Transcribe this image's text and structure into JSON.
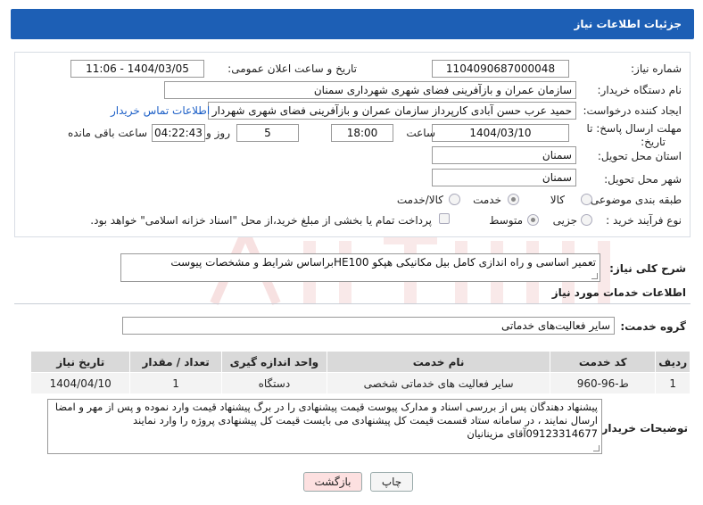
{
  "header": {
    "title": "جزئیات اطلاعات نیاز"
  },
  "form": {
    "need_number_label": "شماره نیاز:",
    "need_number": "1104090687000048",
    "announce_label": "تاریخ و ساعت اعلان عمومی:",
    "announce_value": "1404/03/05 - 11:06",
    "buyer_org_label": "نام دستگاه خریدار:",
    "buyer_org": "سازمان عمران و بازآفرینی فضای شهری شهرداری سمنان",
    "creator_label": "ایجاد کننده درخواست:",
    "creator": "حمید عرب حسن آبادی کارپرداز سازمان عمران و بازآفرینی فضای شهری شهردار",
    "contact_link": "اطلاعات تماس خریدار",
    "deadline_label_1": "مهلت ارسال پاسخ: تا",
    "deadline_label_2": "تاریخ:",
    "deadline_date": "1404/03/10",
    "time_label": "ساعت",
    "deadline_time": "18:00",
    "days_value": "5",
    "days_label": "روز و",
    "remaining_time": "04:22:43",
    "remaining_label": "ساعت باقی مانده",
    "province_label": "استان محل تحویل:",
    "province": "سمنان",
    "city_label": "شهر محل تحویل:",
    "city": "سمنان",
    "category_label": "طبقه بندی موضوعی:",
    "category_options": [
      "کالا",
      "خدمت",
      "کالا/خدمت"
    ],
    "category_selected": "خدمت",
    "process_label": "نوع فرآیند خرید :",
    "process_options": [
      "جزیی",
      "متوسط"
    ],
    "process_selected": "متوسط",
    "payment_note": "پرداخت تمام یا بخشی از مبلغ خرید،از محل \"اسناد خزانه اسلامی\" خواهد بود."
  },
  "summary": {
    "label": "شرح کلی نیاز:",
    "text": "تعمیر اساسی و راه اندازی کامل بیل مکانیکی هپکو HE100براساس شرایط و مشخصات پیوست"
  },
  "services": {
    "section_title": "اطلاعات خدمات مورد نیاز",
    "group_label": "گروه خدمت:",
    "group_value": "سایر فعالیت‌های خدماتی",
    "columns": [
      "ردیف",
      "کد خدمت",
      "نام خدمت",
      "واحد اندازه گیری",
      "تعداد / مقدار",
      "تاریخ نیاز"
    ],
    "rows": [
      [
        "1",
        "ط-96-960",
        "سایر فعالیت های خدماتی شخصی",
        "دستگاه",
        "1",
        "1404/04/10"
      ]
    ]
  },
  "buyer_notes": {
    "label": "توضیحات خریدار:",
    "text": "پیشنهاد دهندگان پس از بررسی اسناد و مدارک پیوست  قیمت پیشنهادی را در برگ پیشنهاد قیمت وارد نموده و پس از مهر و امضا ارسال نمایند ، در سامانه ستاد قسمت قیمت کل پیشنهادی می بایست قیمت کل پیشنهادی پروژه را وارد نمایند 09123314677آقای مزینانیان"
  },
  "buttons": {
    "print": "چاپ",
    "back": "بازگشت"
  },
  "colors": {
    "header_bg": "#1d5fb5",
    "link": "#1c5fc7",
    "back_btn": "#fde0e0"
  }
}
